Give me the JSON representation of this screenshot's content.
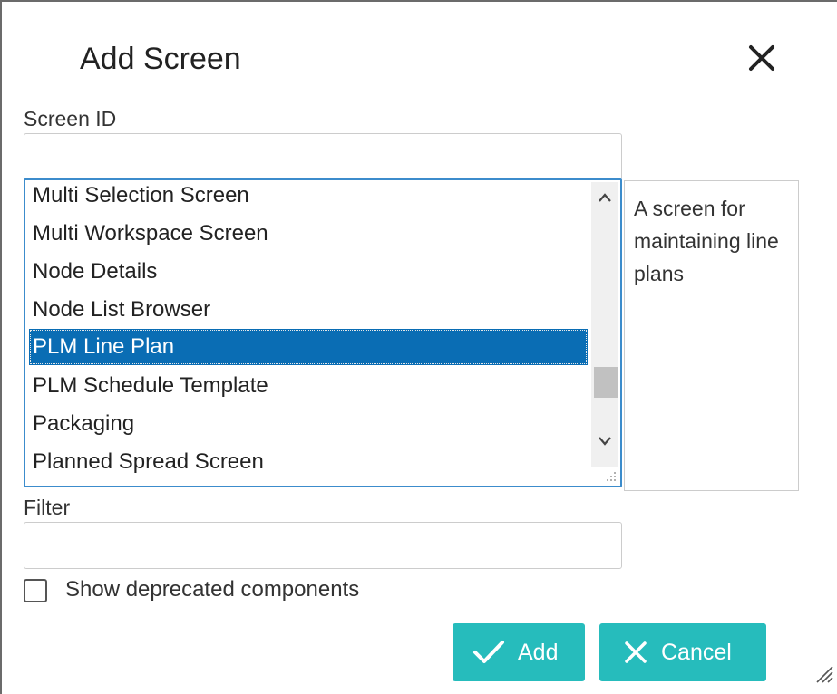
{
  "dialog": {
    "title": "Add Screen",
    "close_icon": "close-icon"
  },
  "screen_id": {
    "label": "Screen ID",
    "value": ""
  },
  "screen_list": {
    "items": [
      "Multi Selection Screen",
      "Multi Workspace Screen",
      "Node Details",
      "Node List Browser",
      "PLM Line Plan",
      "PLM Schedule Template",
      "Packaging",
      "Planned Spread Screen"
    ],
    "selected": "PLM Line Plan",
    "scroll_up_icon": "chevron-up-icon",
    "scroll_down_icon": "chevron-down-icon"
  },
  "description": "A screen for maintaining line plans",
  "filter": {
    "label": "Filter",
    "value": ""
  },
  "deprecated": {
    "label": "Show deprecated components",
    "checked": false
  },
  "buttons": {
    "add_label": "Add",
    "add_icon": "check-icon",
    "cancel_label": "Cancel",
    "cancel_icon": "close-icon"
  },
  "colors": {
    "accent": "#26bcbc",
    "selection": "#0a6db4",
    "focus_border": "#3c8ccc"
  }
}
